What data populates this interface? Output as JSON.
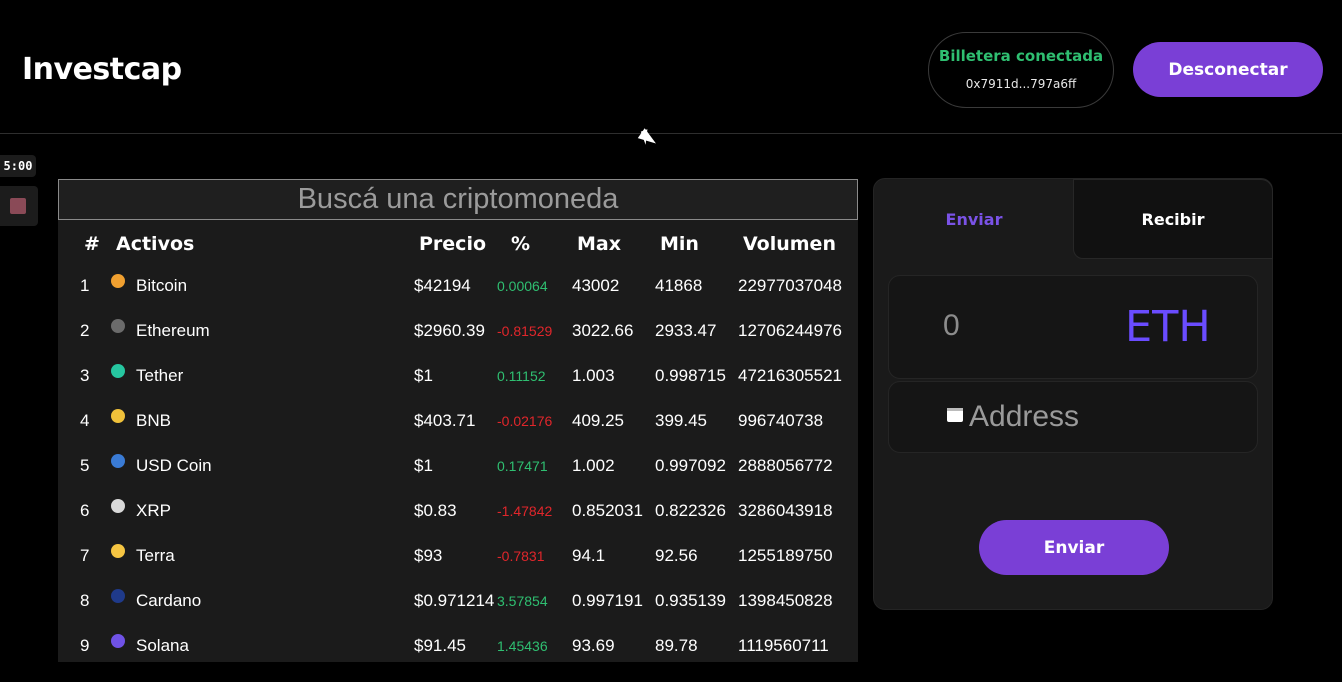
{
  "header": {
    "brand": "Investcap",
    "wallet_status": "Billetera conectada",
    "wallet_address": "0x7911d...797a6ff",
    "disconnect_label": "Desconectar"
  },
  "recorder": {
    "timer": "5:00"
  },
  "market": {
    "search_placeholder": "Buscá una criptomoneda",
    "columns": [
      "#",
      "Activos",
      "Precio",
      "%",
      "Max",
      "Min",
      "Volumen"
    ],
    "rows": [
      {
        "rank": "1",
        "name": "Bitcoin",
        "price": "$42194",
        "pct": "0.00064",
        "max": "43002",
        "min": "41868",
        "volume": "22977037048",
        "icon": "bitcoin-icon",
        "icon_color": "#f0a030",
        "pct_color": "#2fbf71"
      },
      {
        "rank": "2",
        "name": "Ethereum",
        "price": "$2960.39",
        "pct": "-0.81529",
        "max": "3022.66",
        "min": "2933.47",
        "volume": "12706244976",
        "icon": "ethereum-icon",
        "icon_color": "#6b6b6b",
        "pct_color": "#e0262b"
      },
      {
        "rank": "3",
        "name": "Tether",
        "price": "$1",
        "pct": "0.11152",
        "max": "1.003",
        "min": "0.998715",
        "volume": "47216305521",
        "icon": "tether-icon",
        "icon_color": "#26c6a0",
        "pct_color": "#2fbf71"
      },
      {
        "rank": "4",
        "name": "BNB",
        "price": "$403.71",
        "pct": "-0.02176",
        "max": "409.25",
        "min": "399.45",
        "volume": "996740738",
        "icon": "bnb-icon",
        "icon_color": "#f0c13a",
        "pct_color": "#e0262b"
      },
      {
        "rank": "5",
        "name": "USD Coin",
        "price": "$1",
        "pct": "0.17471",
        "max": "1.002",
        "min": "0.997092",
        "volume": "2888056772",
        "icon": "usd-coin-icon",
        "icon_color": "#3a7bd5",
        "pct_color": "#2fbf71"
      },
      {
        "rank": "6",
        "name": "XRP",
        "price": "$0.83",
        "pct": "-1.47842",
        "max": "0.852031",
        "min": "0.822326",
        "volume": "3286043918",
        "icon": "xrp-icon",
        "icon_color": "#d9d9d9",
        "pct_color": "#e0262b"
      },
      {
        "rank": "7",
        "name": "Terra",
        "price": "$93",
        "pct": "-0.7831",
        "max": "94.1",
        "min": "92.56",
        "volume": "1255189750",
        "icon": "terra-icon",
        "icon_color": "#f5c542",
        "pct_color": "#e0262b"
      },
      {
        "rank": "8",
        "name": "Cardano",
        "price": "$0.971214",
        "pct": "3.57854",
        "max": "0.997191",
        "min": "0.935139",
        "volume": "1398450828",
        "icon": "cardano-icon",
        "icon_color": "#1f3a8a",
        "pct_color": "#2fbf71"
      },
      {
        "rank": "9",
        "name": "Solana",
        "price": "$91.45",
        "pct": "1.45436",
        "max": "93.69",
        "min": "89.78",
        "volume": "1119560711",
        "icon": "solana-icon",
        "icon_color": "#6f52e6",
        "pct_color": "#2fbf71"
      }
    ]
  },
  "transfer": {
    "tab_send": "Enviar",
    "tab_receive": "Recibir",
    "amount_value": "0",
    "currency": "ETH",
    "address_placeholder": "Address",
    "send_label": "Enviar"
  }
}
